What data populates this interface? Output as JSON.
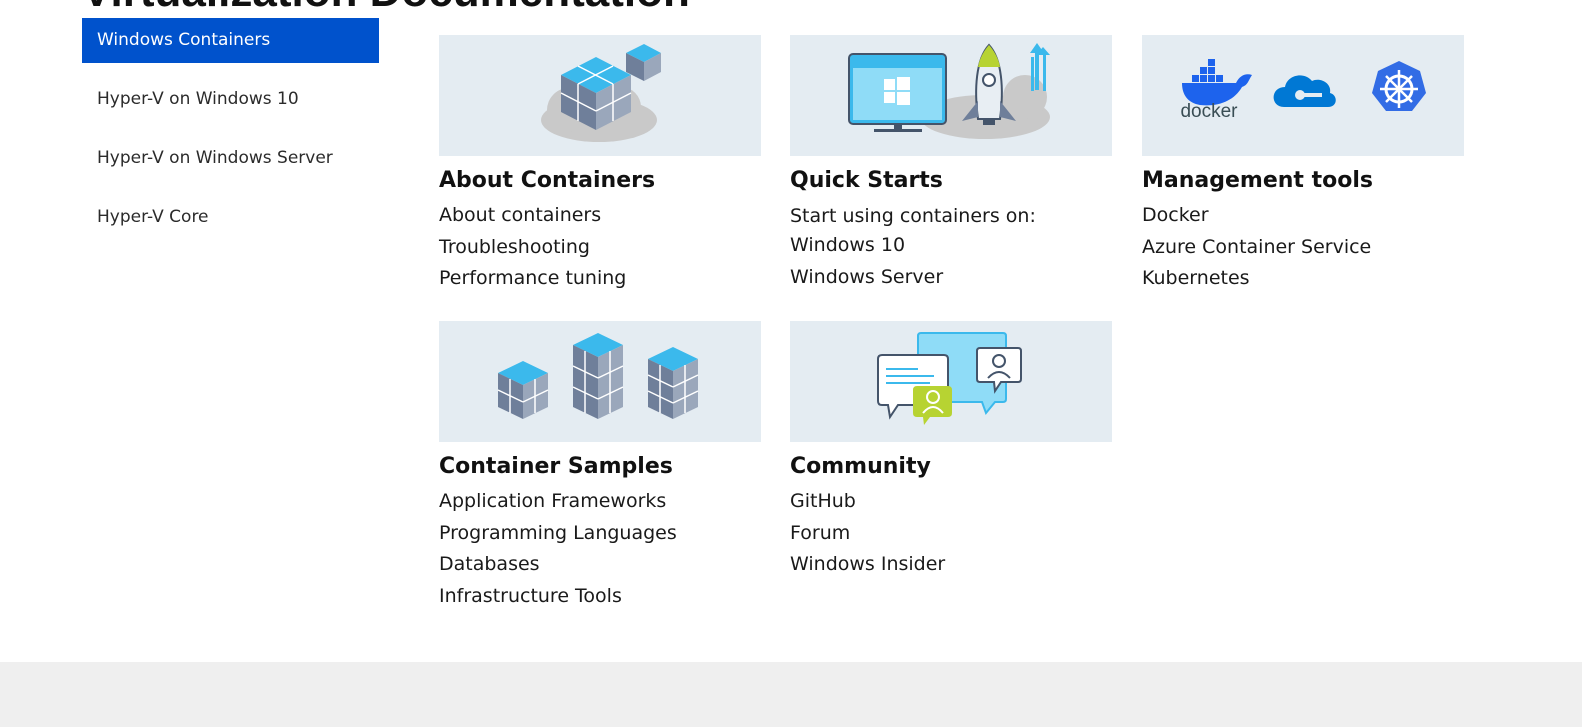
{
  "page": {
    "title": "Virtualization Documentation"
  },
  "sidebar": {
    "items": [
      {
        "label": "Windows Containers",
        "active": true
      },
      {
        "label": "Hyper-V on Windows 10"
      },
      {
        "label": "Hyper-V on Windows Server"
      },
      {
        "label": "Hyper-V Core"
      }
    ]
  },
  "cards": [
    {
      "title": "About Containers",
      "icon": "containers-cloud-icon",
      "links": [
        "About containers",
        "Troubleshooting",
        "Performance tuning"
      ]
    },
    {
      "title": "Quick Starts",
      "icon": "rocket-monitor-icon",
      "subtitle": "Start using containers on:",
      "links": [
        "Windows 10",
        "Windows Server"
      ]
    },
    {
      "title": "Management tools",
      "icons": [
        "docker-logo",
        "azure-cloud-icon",
        "kubernetes-logo"
      ],
      "logo_text": "docker",
      "links": [
        "Docker",
        "Azure Container Service",
        "Kubernetes"
      ]
    },
    {
      "title": "Container Samples",
      "icon": "container-stacks-icon",
      "links": [
        "Application Frameworks",
        "Programming Languages",
        "Databases",
        "Infrastructure Tools"
      ]
    },
    {
      "title": "Community",
      "icon": "chat-bubbles-icon",
      "links": [
        "GitHub",
        "Forum",
        "Windows Insider"
      ]
    }
  ],
  "colors": {
    "accent": "#0052cc",
    "banner_bg": "#e4ecf2",
    "footer_bg": "#efefef",
    "cube_top": "#3bb9ec",
    "cube_side": "#6f7f9a",
    "lime": "#b7d332",
    "kubernetes": "#326ce5",
    "azure": "#0078d4"
  }
}
